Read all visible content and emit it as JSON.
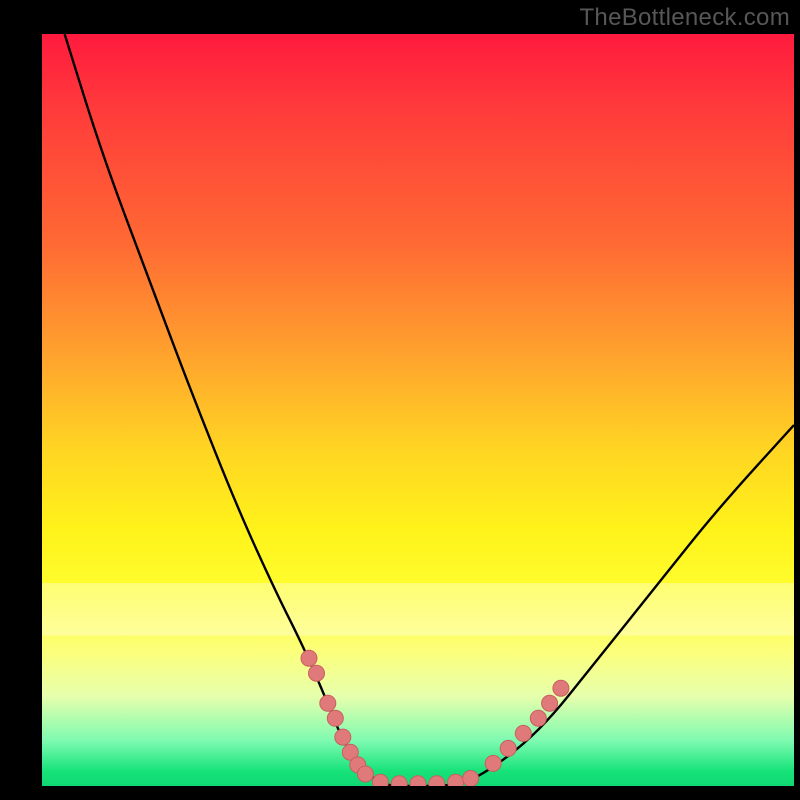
{
  "watermark": "TheBottleneck.com",
  "chart_data": {
    "type": "line",
    "title": "",
    "xlabel": "",
    "ylabel": "",
    "xlim": [
      0,
      100
    ],
    "ylim": [
      0,
      100
    ],
    "series": [
      {
        "name": "curve",
        "x": [
          3,
          8,
          14,
          20,
          26,
          31,
          35,
          38,
          40,
          42,
          44,
          46,
          50,
          54,
          58,
          66,
          74,
          82,
          90,
          100
        ],
        "y": [
          100,
          84,
          68,
          52,
          37,
          26,
          18,
          11,
          6,
          3,
          1,
          0,
          0,
          0,
          1,
          7,
          17,
          27,
          37,
          48
        ]
      }
    ],
    "scatter": [
      {
        "name": "dots-left",
        "x": [
          35.5,
          36.5,
          38,
          39,
          40,
          41,
          42,
          43
        ],
        "y": [
          17,
          15,
          11,
          9,
          6.5,
          4.5,
          2.8,
          1.6
        ]
      },
      {
        "name": "dots-bottom",
        "x": [
          45,
          47.5,
          50,
          52.5,
          55,
          57
        ],
        "y": [
          0.5,
          0.3,
          0.3,
          0.3,
          0.5,
          1.0
        ]
      },
      {
        "name": "dots-right",
        "x": [
          60,
          62,
          64,
          66,
          67.5,
          69
        ],
        "y": [
          3,
          5,
          7,
          9,
          11,
          13
        ]
      }
    ],
    "bands": [
      {
        "name": "pale-band-1",
        "y0": 74,
        "y1": 80
      }
    ],
    "colors": {
      "curve": "#000000",
      "dot_fill": "#e07a7a",
      "dot_stroke": "#c85f5f"
    }
  }
}
